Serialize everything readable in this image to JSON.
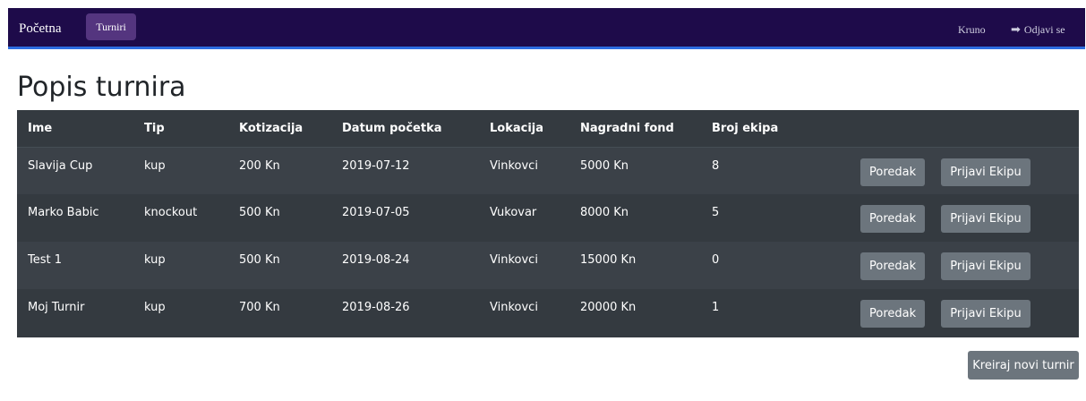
{
  "nav": {
    "brand": "Početna",
    "active_item": "Turniri",
    "user": "Kruno",
    "logout_label": "Odjavi se",
    "logout_icon": "sign-out-icon"
  },
  "page_title": "Popis turnira",
  "table": {
    "columns": [
      "Ime",
      "Tip",
      "Kotizacija",
      "Datum početka",
      "Lokacija",
      "Nagradni fond",
      "Broj ekipa",
      ""
    ],
    "rows": [
      {
        "ime": "Slavija Cup",
        "tip": "kup",
        "kotizacija": "200 Kn",
        "datum": "2019-07-12",
        "lokacija": "Vinkovci",
        "fond": "5000 Kn",
        "ekipa": "8",
        "btn_poredak": "Poredak",
        "btn_prijavi": "Prijavi Ekipu"
      },
      {
        "ime": "Marko Babic",
        "tip": "knockout",
        "kotizacija": "500 Kn",
        "datum": "2019-07-05",
        "lokacija": "Vukovar",
        "fond": "8000 Kn",
        "ekipa": "5",
        "btn_poredak": "Poredak",
        "btn_prijavi": "Prijavi Ekipu"
      },
      {
        "ime": "Test 1",
        "tip": "kup",
        "kotizacija": "500 Kn",
        "datum": "2019-08-24",
        "lokacija": "Vinkovci",
        "fond": "15000 Kn",
        "ekipa": "0",
        "btn_poredak": "Poredak",
        "btn_prijavi": "Prijavi Ekipu"
      },
      {
        "ime": "Moj Turnir",
        "tip": "kup",
        "kotizacija": "700 Kn",
        "datum": "2019-08-26",
        "lokacija": "Vinkovci",
        "fond": "20000 Kn",
        "ekipa": "1",
        "btn_poredak": "Poredak",
        "btn_prijavi": "Prijavi Ekipu"
      }
    ]
  },
  "create_button": "Kreiraj novi turnir",
  "colors": {
    "navbar": "#1e0b4a",
    "navbar_border": "#2d6de0",
    "active_pill": "#54357f",
    "table_bg": "#343a40",
    "table_stripe": "#3b4148",
    "button": "#6c757d"
  }
}
